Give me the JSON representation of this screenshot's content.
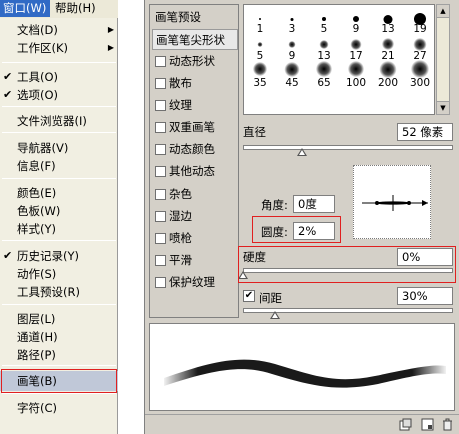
{
  "menu_bar": {
    "window_label": "窗口(W)",
    "help_label": "帮助(H)"
  },
  "menu": {
    "items": [
      {
        "label": "文档(D)",
        "checked": false,
        "submenu": true
      },
      {
        "label": "工作区(K)",
        "checked": false,
        "submenu": true
      },
      {
        "label": "工具(O)",
        "checked": true,
        "submenu": false
      },
      {
        "label": "选项(O)",
        "checked": true,
        "submenu": false
      },
      {
        "label": "文件浏览器(I)",
        "checked": false,
        "submenu": false
      },
      {
        "label": "导航器(V)",
        "checked": false,
        "submenu": false
      },
      {
        "label": "信息(F)",
        "checked": false,
        "submenu": false
      },
      {
        "label": "颜色(E)",
        "checked": false,
        "submenu": false
      },
      {
        "label": "色板(W)",
        "checked": false,
        "submenu": false
      },
      {
        "label": "样式(Y)",
        "checked": false,
        "submenu": false
      },
      {
        "label": "历史记录(Y)",
        "checked": true,
        "submenu": false
      },
      {
        "label": "动作(S)",
        "checked": false,
        "submenu": false
      },
      {
        "label": "工具预设(R)",
        "checked": false,
        "submenu": false
      },
      {
        "label": "图层(L)",
        "checked": false,
        "submenu": false
      },
      {
        "label": "通道(H)",
        "checked": false,
        "submenu": false
      },
      {
        "label": "路径(P)",
        "checked": false,
        "submenu": false
      },
      {
        "label": "画笔(B)",
        "checked": false,
        "submenu": false
      },
      {
        "label": "字符(C)",
        "checked": false,
        "submenu": false
      }
    ],
    "check_glyph": "✔",
    "submenu_glyph": "▶"
  },
  "brush_options": [
    {
      "label": "画笔预设",
      "has_checkbox": false,
      "checked": false
    },
    {
      "label": "画笔笔尖形状",
      "has_checkbox": false,
      "checked": false
    },
    {
      "label": "动态形状",
      "has_checkbox": true,
      "checked": false
    },
    {
      "label": "散布",
      "has_checkbox": true,
      "checked": false
    },
    {
      "label": "纹理",
      "has_checkbox": true,
      "checked": false
    },
    {
      "label": "双重画笔",
      "has_checkbox": true,
      "checked": false
    },
    {
      "label": "动态颜色",
      "has_checkbox": true,
      "checked": false
    },
    {
      "label": "其他动态",
      "has_checkbox": true,
      "checked": false
    },
    {
      "label": "杂色",
      "has_checkbox": true,
      "checked": false
    },
    {
      "label": "湿边",
      "has_checkbox": true,
      "checked": false
    },
    {
      "label": "喷枪",
      "has_checkbox": true,
      "checked": false
    },
    {
      "label": "平滑",
      "has_checkbox": true,
      "checked": false
    },
    {
      "label": "保护纹理",
      "has_checkbox": true,
      "checked": false
    }
  ],
  "presets": {
    "rows": [
      [
        {
          "n": "1",
          "s": "hard",
          "d": 2
        },
        {
          "n": "3",
          "s": "hard",
          "d": 3
        },
        {
          "n": "5",
          "s": "hard",
          "d": 4
        },
        {
          "n": "9",
          "s": "hard",
          "d": 6
        },
        {
          "n": "13",
          "s": "hard",
          "d": 9
        },
        {
          "n": "19",
          "s": "hard",
          "d": 12
        }
      ],
      [
        {
          "n": "5",
          "s": "soft",
          "d": 5
        },
        {
          "n": "9",
          "s": "soft",
          "d": 7
        },
        {
          "n": "13",
          "s": "soft",
          "d": 9
        },
        {
          "n": "17",
          "s": "soft",
          "d": 11
        },
        {
          "n": "21",
          "s": "soft",
          "d": 12
        },
        {
          "n": "27",
          "s": "soft",
          "d": 13
        }
      ],
      [
        {
          "n": "35",
          "s": "soft",
          "d": 14
        },
        {
          "n": "45",
          "s": "soft",
          "d": 15
        },
        {
          "n": "65",
          "s": "soft",
          "d": 16
        },
        {
          "n": "100",
          "s": "soft",
          "d": 16
        },
        {
          "n": "200",
          "s": "soft",
          "d": 17
        },
        {
          "n": "300",
          "s": "soft",
          "d": 18
        }
      ]
    ]
  },
  "diameter": {
    "label": "直径",
    "value": "52 像素",
    "fraction": 0.28
  },
  "angle": {
    "label": "角度:",
    "value": "0度"
  },
  "roundness": {
    "label": "圆度:",
    "value": "2%"
  },
  "hardness": {
    "label": "硬度",
    "value": "0%",
    "fraction": 0.0
  },
  "spacing": {
    "label": "间距",
    "value": "30%",
    "checked": true,
    "fraction": 0.15
  },
  "colors": {
    "highlight_red": "#e02020",
    "menu_selected_blue": "#316ac5",
    "panel_gray": "#d4d0c8"
  },
  "icons": {
    "scroll_up": "▲",
    "scroll_down": "▼",
    "check_mark": "✔"
  }
}
